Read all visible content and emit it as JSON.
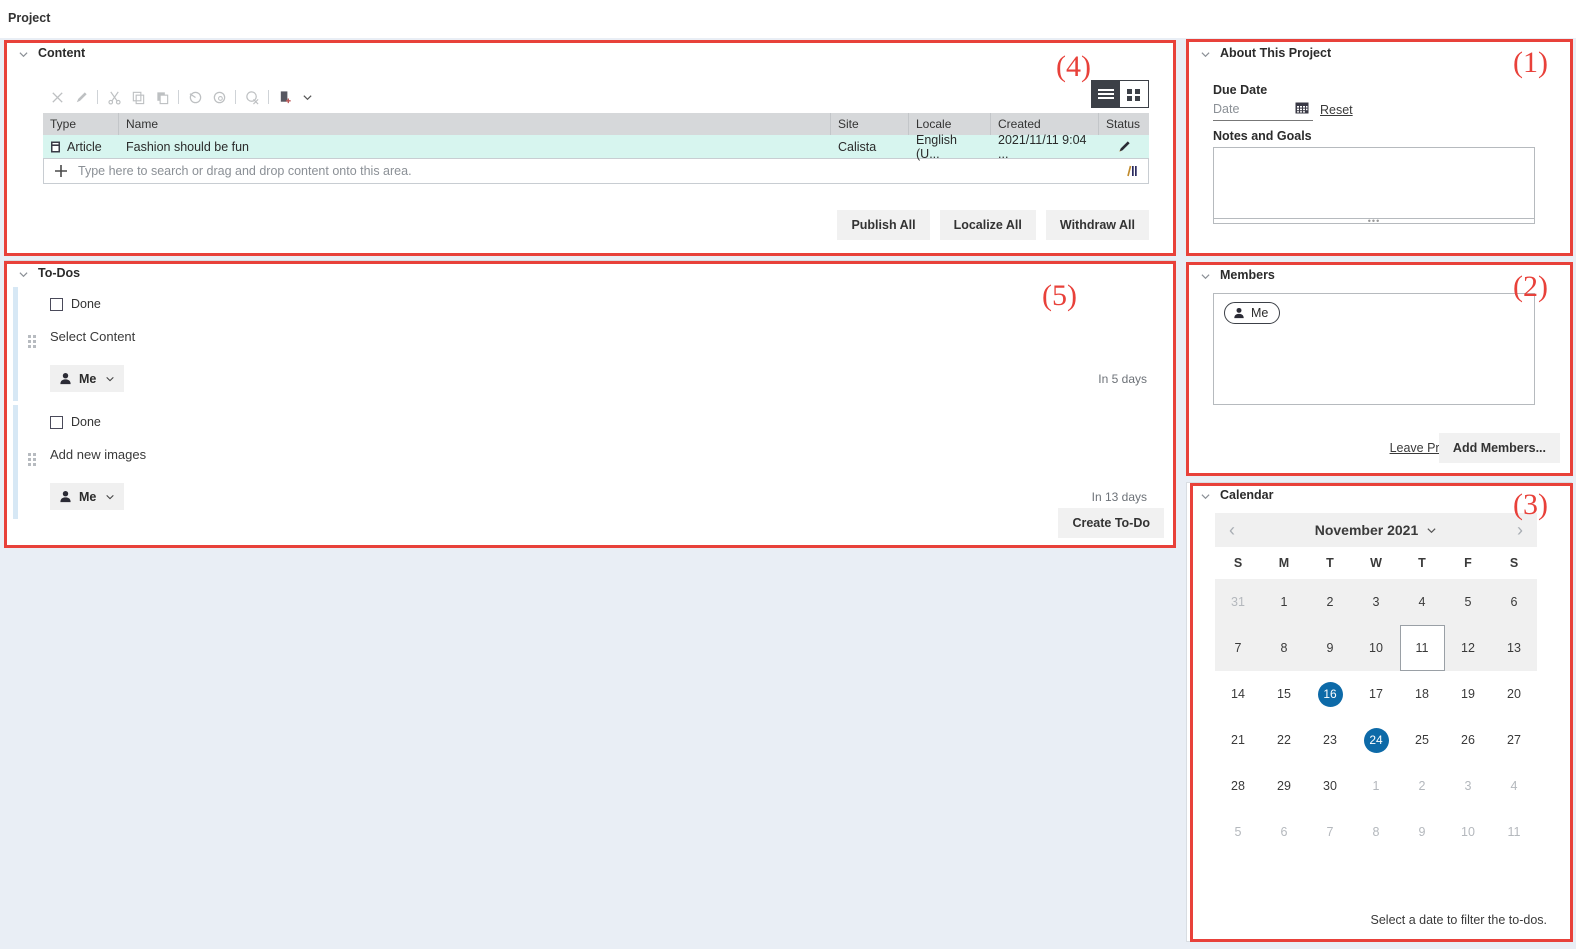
{
  "page": {
    "title": "Project"
  },
  "annotations": [
    {
      "label": "(1)"
    },
    {
      "label": "(2)"
    },
    {
      "label": "(3)"
    },
    {
      "label": "(4)"
    },
    {
      "label": "(5)"
    }
  ],
  "content_panel": {
    "title": "Content",
    "toolbar": [
      {
        "name": "delete-icon",
        "label": "Delete"
      },
      {
        "name": "edit-icon",
        "label": "Edit"
      },
      {
        "name": "cut-icon",
        "label": "Cut"
      },
      {
        "name": "copy-icon",
        "label": "Copy"
      },
      {
        "name": "paste-icon",
        "label": "Paste"
      },
      {
        "name": "publish-icon",
        "label": "Publish"
      },
      {
        "name": "unpublish-icon",
        "label": "Unpublish"
      },
      {
        "name": "withdraw-icon",
        "label": "Withdraw"
      },
      {
        "name": "new-content-icon",
        "label": "New"
      }
    ],
    "view_toggle": {
      "list_label": "List view",
      "grid_label": "Grid view",
      "selected": "list"
    },
    "table": {
      "columns": [
        "Type",
        "Name",
        "Site",
        "Locale",
        "Created",
        "Status"
      ],
      "rows": [
        {
          "type": "Article",
          "name": "Fashion should be fun",
          "site": "Calista",
          "locale": "English (U...",
          "created": "2021/11/11 9:04 ...",
          "status_icon": "edit-pencil-icon"
        }
      ],
      "add_row_placeholder": "Type here to search or drag and drop content onto this area."
    },
    "buttons": [
      {
        "label": "Publish All"
      },
      {
        "label": "Localize All"
      },
      {
        "label": "Withdraw All"
      }
    ]
  },
  "todos_panel": {
    "title": "To-Dos",
    "items": [
      {
        "done_label": "Done",
        "checked": false,
        "text": "Select Content",
        "assignee": "Me",
        "due": "In 5 days"
      },
      {
        "done_label": "Done",
        "checked": false,
        "text": "Add new images",
        "assignee": "Me",
        "due": "In 13 days"
      }
    ],
    "create_button": "Create To-Do"
  },
  "about_panel": {
    "title": "About This Project",
    "due_date_label": "Due Date",
    "date_placeholder": "Date",
    "date_value": "",
    "reset_label": "Reset",
    "notes_label": "Notes and Goals",
    "notes_value": ""
  },
  "members_panel": {
    "title": "Members",
    "members": [
      {
        "name": "Me"
      }
    ],
    "leave_label": "Leave Project",
    "add_label": "Add Members..."
  },
  "calendar_panel": {
    "title": "Calendar",
    "month_label": "November 2021",
    "prev_label": "Previous month",
    "next_label": "Next month",
    "dow": [
      "S",
      "M",
      "T",
      "W",
      "T",
      "F",
      "S"
    ],
    "weeks": [
      [
        {
          "d": "31",
          "muted": true
        },
        {
          "d": "1"
        },
        {
          "d": "2"
        },
        {
          "d": "3"
        },
        {
          "d": "4"
        },
        {
          "d": "5"
        },
        {
          "d": "6"
        }
      ],
      [
        {
          "d": "7"
        },
        {
          "d": "8"
        },
        {
          "d": "9"
        },
        {
          "d": "10"
        },
        {
          "d": "11",
          "today": true
        },
        {
          "d": "12"
        },
        {
          "d": "13"
        }
      ],
      [
        {
          "d": "14"
        },
        {
          "d": "15"
        },
        {
          "d": "16",
          "selected": true
        },
        {
          "d": "17"
        },
        {
          "d": "18"
        },
        {
          "d": "19"
        },
        {
          "d": "20"
        }
      ],
      [
        {
          "d": "21"
        },
        {
          "d": "22"
        },
        {
          "d": "23"
        },
        {
          "d": "24",
          "selected": true
        },
        {
          "d": "25"
        },
        {
          "d": "26"
        },
        {
          "d": "27"
        }
      ],
      [
        {
          "d": "28"
        },
        {
          "d": "29"
        },
        {
          "d": "30"
        },
        {
          "d": "1",
          "muted": true
        },
        {
          "d": "2",
          "muted": true
        },
        {
          "d": "3",
          "muted": true
        },
        {
          "d": "4",
          "muted": true
        }
      ],
      [
        {
          "d": "5",
          "muted": true
        },
        {
          "d": "6",
          "muted": true
        },
        {
          "d": "7",
          "muted": true
        },
        {
          "d": "8",
          "muted": true
        },
        {
          "d": "9",
          "muted": true
        },
        {
          "d": "10",
          "muted": true
        },
        {
          "d": "11",
          "muted": true
        }
      ]
    ],
    "shaded_weeks": [
      0,
      1
    ],
    "hint": "Select a date to filter the to-dos.",
    "accent_color": "#0d6aa8"
  }
}
